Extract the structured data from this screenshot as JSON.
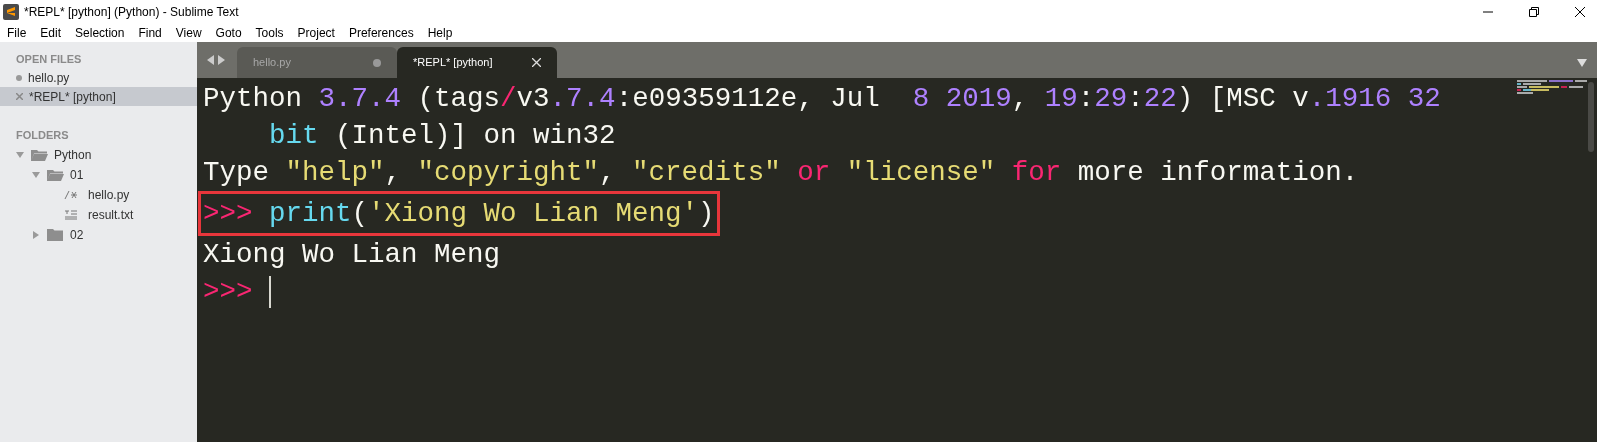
{
  "window": {
    "title": "*REPL* [python] (Python) - Sublime Text"
  },
  "menu": [
    "File",
    "Edit",
    "Selection",
    "Find",
    "View",
    "Goto",
    "Tools",
    "Project",
    "Preferences",
    "Help"
  ],
  "sidebar": {
    "open_files_heading": "OPEN FILES",
    "open_files": [
      {
        "name": "hello.py",
        "selected": false,
        "kind": "dirty"
      },
      {
        "name": "*REPL* [python]",
        "selected": true,
        "kind": "closable"
      }
    ],
    "folders_heading": "FOLDERS",
    "tree": [
      {
        "name": "Python",
        "kind": "folder",
        "expanded": true,
        "children": [
          {
            "name": "01",
            "kind": "folder",
            "expanded": true,
            "children": [
              {
                "name": "hello.py",
                "kind": "code_file"
              },
              {
                "name": "result.txt",
                "kind": "text_file"
              }
            ]
          },
          {
            "name": "02",
            "kind": "folder",
            "expanded": false
          }
        ]
      }
    ]
  },
  "tabs": [
    {
      "label": "hello.py",
      "selected": false,
      "dirty": true
    },
    {
      "label": "*REPL* [python]",
      "selected": true,
      "dirty": false
    }
  ],
  "editor": {
    "lines": [
      {
        "indent": false,
        "highlighted": false,
        "tokens": [
          {
            "text": "Python ",
            "kind": "plain"
          },
          {
            "text": "3.7.4",
            "kind": "number"
          },
          {
            "text": " (tags",
            "kind": "plain"
          },
          {
            "text": "/",
            "kind": "keyword"
          },
          {
            "text": "v3",
            "kind": "plain"
          },
          {
            "text": ".7.4",
            "kind": "number"
          },
          {
            "text": ":e09359112e, Jul  ",
            "kind": "plain"
          },
          {
            "text": "8 2019",
            "kind": "number"
          },
          {
            "text": ", ",
            "kind": "plain"
          },
          {
            "text": "19",
            "kind": "number"
          },
          {
            "text": ":",
            "kind": "plain"
          },
          {
            "text": "29",
            "kind": "number"
          },
          {
            "text": ":",
            "kind": "plain"
          },
          {
            "text": "22",
            "kind": "number"
          },
          {
            "text": ") [MSC v",
            "kind": "plain"
          },
          {
            "text": ".1916 32",
            "kind": "number"
          }
        ]
      },
      {
        "indent": true,
        "highlighted": false,
        "tokens": [
          {
            "text": "bit",
            "kind": "builtin"
          },
          {
            "text": " (Intel)] on win32",
            "kind": "plain"
          }
        ]
      },
      {
        "indent": false,
        "highlighted": false,
        "tokens": [
          {
            "text": "Type ",
            "kind": "plain"
          },
          {
            "text": "\"help\"",
            "kind": "string"
          },
          {
            "text": ", ",
            "kind": "plain"
          },
          {
            "text": "\"copyright\"",
            "kind": "string"
          },
          {
            "text": ", ",
            "kind": "plain"
          },
          {
            "text": "\"credits\" ",
            "kind": "string"
          },
          {
            "text": "or ",
            "kind": "keyword"
          },
          {
            "text": "\"license\" ",
            "kind": "string"
          },
          {
            "text": "for",
            "kind": "keyword"
          },
          {
            "text": " more information.",
            "kind": "plain"
          }
        ]
      },
      {
        "indent": false,
        "highlighted": true,
        "tokens": [
          {
            "text": ">>> ",
            "kind": "keyword"
          },
          {
            "text": "print",
            "kind": "builtin"
          },
          {
            "text": "(",
            "kind": "plain"
          },
          {
            "text": "'Xiong Wo Lian Meng'",
            "kind": "string"
          },
          {
            "text": ")",
            "kind": "plain"
          }
        ]
      },
      {
        "indent": false,
        "highlighted": false,
        "tokens": [
          {
            "text": "Xiong Wo Lian Meng",
            "kind": "plain"
          }
        ]
      },
      {
        "indent": false,
        "highlighted": false,
        "cursor": true,
        "tokens": [
          {
            "text": ">>>",
            "kind": "keyword"
          }
        ]
      }
    ]
  }
}
